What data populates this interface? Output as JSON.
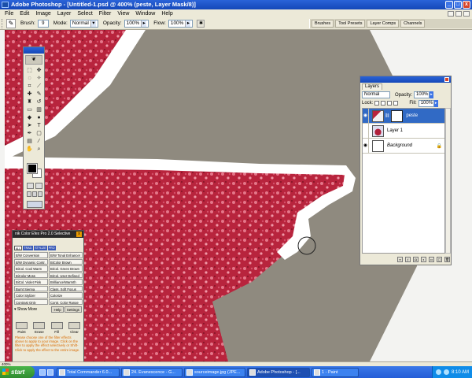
{
  "window": {
    "title": "Adobe Photoshop - [Untitled-1.psd @ 400% (peste, Layer Mask/8)]",
    "controls": [
      "_",
      "□",
      "x"
    ]
  },
  "menu": [
    "File",
    "Edit",
    "Image",
    "Layer",
    "Select",
    "Filter",
    "View",
    "Window",
    "Help"
  ],
  "options": {
    "brush_label": "Brush:",
    "brush_size": "9",
    "mode_label": "Mode:",
    "mode_value": "Normal",
    "opacity_label": "Opacity:",
    "opacity_value": "100%",
    "flow_label": "Flow:",
    "flow_value": "100%"
  },
  "palette_well": [
    "Brushes",
    "Tool Presets",
    "Layer Comps",
    "Channels"
  ],
  "layers_panel": {
    "tab": "Layers",
    "blend_mode": "Normal",
    "opacity_label": "Opacity:",
    "opacity_value": "100%",
    "lock_label": "Lock:",
    "fill_label": "Fill:",
    "fill_value": "100%",
    "layers": [
      {
        "name": "peste",
        "active": true
      },
      {
        "name": "Layer 1",
        "active": false
      },
      {
        "name": "Background",
        "active": false
      }
    ]
  },
  "nik_panel": {
    "title": "nik Color Efex Pro 2.0 Selective",
    "tabs": [
      "ALL",
      "TRAD.",
      "STYLIZE",
      "PRO"
    ],
    "filters": [
      "B/W Conversion",
      "B/W Tonal Enhancer",
      "B/W Dynamic Contr.",
      "BiColor Brown",
      "BiCol. Cool Warm",
      "BiCol. Green Brown",
      "BiColor Moss",
      "BiCol. User Defined",
      "BiCol. Violet Pink",
      "Brilliance/Warmth",
      "Burnt Sienna",
      "Class. Soft Focus",
      "Color Stylizer",
      "Colorize",
      "Contrast Only",
      "Contr. Color Range"
    ],
    "show_more": "Show More",
    "help": "Help",
    "settings": "Settings",
    "actions": [
      "Paint",
      "Erase",
      "Fill",
      "Clear"
    ],
    "help_text": "Please choose one of the filter effects above to apply to your image. Click on the filter to apply the effect selectively or Shift-Click to apply the effect to the entire image."
  },
  "status": {
    "zoom": "400%"
  },
  "taskbar": {
    "start": "start",
    "buttons": [
      "Total Commander 6.0...",
      "24. Evanescence - G...",
      "sourceimage.jpg (JPE...",
      "Adobe Photoshop - [...",
      "1 - Paint"
    ],
    "clock": "8:10 AM"
  },
  "colors": {
    "canvas_gray": "#8f8a7f",
    "petal_red": "#b8243d",
    "selection_blue": "#316ac5",
    "titlebar_blue": "#1e57c8"
  }
}
